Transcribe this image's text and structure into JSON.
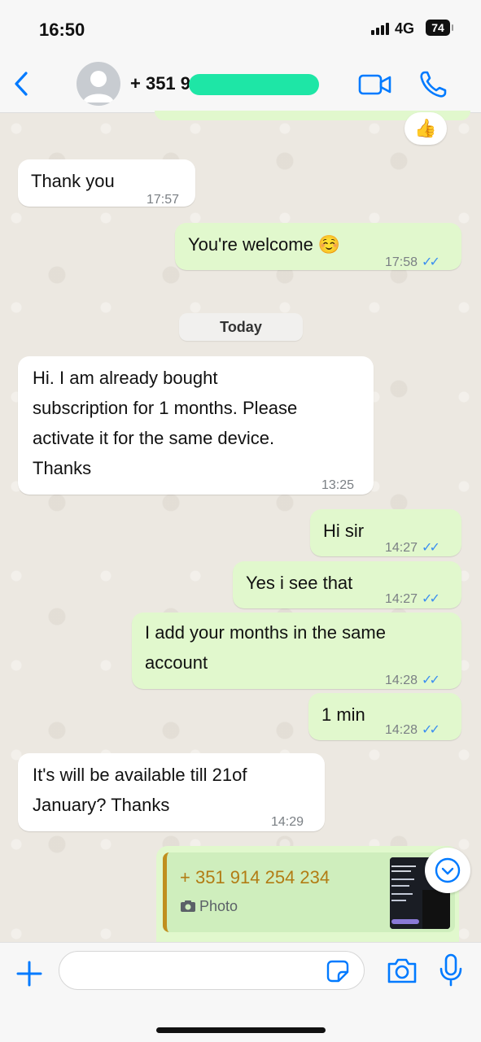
{
  "status_bar": {
    "time": "16:50",
    "network": "4G",
    "battery": "74"
  },
  "header": {
    "contact_name": "+ 351 9"
  },
  "day_divider": "Today",
  "reaction_emoji": "👍",
  "messages": [
    {
      "direction": "in",
      "lines": [
        "Thank you"
      ],
      "time": "17:57"
    },
    {
      "direction": "out",
      "lines": [
        "You're welcome ☺️"
      ],
      "time": "17:58",
      "read": true
    },
    {
      "direction": "in",
      "lines": [
        "Hi. I am already bought",
        "subscription for 1 months.  Please",
        "activate it for the same device.",
        "Thanks"
      ],
      "time": "13:25"
    },
    {
      "direction": "out",
      "lines": [
        "Hi sir"
      ],
      "time": "14:27",
      "read": true
    },
    {
      "direction": "out",
      "lines": [
        "Yes i see that"
      ],
      "time": "14:27",
      "read": true
    },
    {
      "direction": "out",
      "lines": [
        "I add your months in the same",
        "account"
      ],
      "time": "14:28",
      "read": true
    },
    {
      "direction": "out",
      "lines": [
        "1 min"
      ],
      "time": "14:28",
      "read": true
    },
    {
      "direction": "in",
      "lines": [
        "It's will be available till 21of",
        "January? Thanks"
      ],
      "time": "14:29"
    }
  ],
  "contact_card": {
    "number": "+ 351 914 254 234",
    "attachment_label": "Photo"
  },
  "composer": {
    "placeholder": ""
  },
  "colors": {
    "accent": "#007aff",
    "outgoing_bubble": "#e1f8cd",
    "incoming_bubble": "#ffffff",
    "read_ticks": "#3b8ef0"
  }
}
